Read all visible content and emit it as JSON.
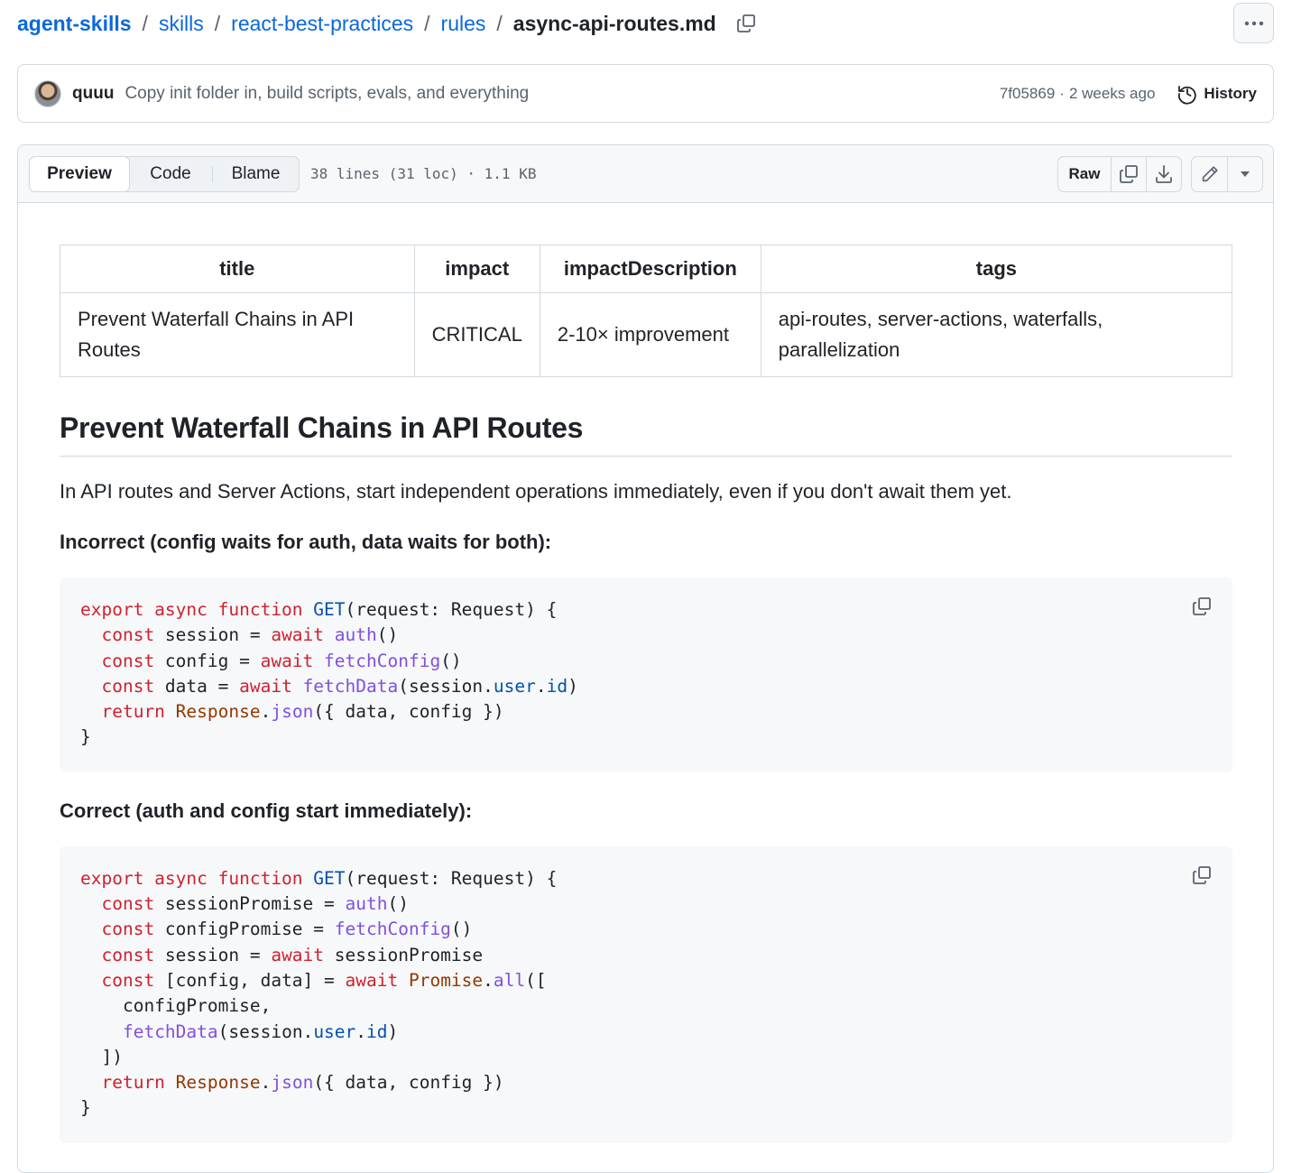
{
  "breadcrumb": {
    "parts": [
      "agent-skills",
      "skills",
      "react-best-practices",
      "rules"
    ],
    "current": "async-api-routes.md",
    "separator": "/"
  },
  "commit": {
    "author": "quuu",
    "message": "Copy init folder in, build scripts, evals, and everything",
    "hash": "7f05869",
    "time": "2 weeks ago",
    "meta_sep": "·",
    "history_label": "History"
  },
  "file_header": {
    "tabs": [
      "Preview",
      "Code",
      "Blame"
    ],
    "active_tab": "Preview",
    "stats": "38 lines (31 loc) · 1.1 KB",
    "raw_label": "Raw"
  },
  "frontmatter": {
    "headers": [
      "title",
      "impact",
      "impactDescription",
      "tags"
    ],
    "row": [
      "Prevent Waterfall Chains in API Routes",
      "CRITICAL",
      "2-10× improvement",
      "api-routes, server-actions, waterfalls, parallelization"
    ]
  },
  "doc": {
    "heading": "Prevent Waterfall Chains in API Routes",
    "intro": "In API routes and Server Actions, start independent operations immediately, even if you don't await them yet.",
    "incorrect_label": "Incorrect (config waits for auth, data waits for both):",
    "correct_label": "Correct (auth and config start immediately):",
    "incorrect_code": [
      [
        [
          "kw",
          "export async function "
        ],
        [
          "en",
          "GET"
        ],
        [
          "",
          "(request: Request) {"
        ]
      ],
      [
        [
          "",
          "  "
        ],
        [
          "kw",
          "const"
        ],
        [
          "",
          " session = "
        ],
        [
          "kw",
          "await "
        ],
        [
          "fn",
          "auth"
        ],
        [
          "",
          "()"
        ]
      ],
      [
        [
          "",
          "  "
        ],
        [
          "kw",
          "const"
        ],
        [
          "",
          " config = "
        ],
        [
          "kw",
          "await "
        ],
        [
          "fn",
          "fetchConfig"
        ],
        [
          "",
          "()"
        ]
      ],
      [
        [
          "",
          "  "
        ],
        [
          "kw",
          "const"
        ],
        [
          "",
          " data = "
        ],
        [
          "kw",
          "await "
        ],
        [
          "fn",
          "fetchData"
        ],
        [
          "",
          "(session."
        ],
        [
          "en",
          "user"
        ],
        [
          "",
          "."
        ],
        [
          "en",
          "id"
        ],
        [
          "",
          ")"
        ]
      ],
      [
        [
          "",
          "  "
        ],
        [
          "kw",
          "return "
        ],
        [
          "cls",
          "Response"
        ],
        [
          "",
          "."
        ],
        [
          "fn",
          "json"
        ],
        [
          "",
          "({ data, config })"
        ]
      ],
      [
        [
          "",
          "}"
        ]
      ]
    ],
    "correct_code": [
      [
        [
          "kw",
          "export async function "
        ],
        [
          "en",
          "GET"
        ],
        [
          "",
          "(request: Request) {"
        ]
      ],
      [
        [
          "",
          "  "
        ],
        [
          "kw",
          "const"
        ],
        [
          "",
          " sessionPromise = "
        ],
        [
          "fn",
          "auth"
        ],
        [
          "",
          "()"
        ]
      ],
      [
        [
          "",
          "  "
        ],
        [
          "kw",
          "const"
        ],
        [
          "",
          " configPromise = "
        ],
        [
          "fn",
          "fetchConfig"
        ],
        [
          "",
          "()"
        ]
      ],
      [
        [
          "",
          "  "
        ],
        [
          "kw",
          "const"
        ],
        [
          "",
          " session = "
        ],
        [
          "kw",
          "await"
        ],
        [
          "",
          " sessionPromise"
        ]
      ],
      [
        [
          "",
          "  "
        ],
        [
          "kw",
          "const"
        ],
        [
          "",
          " [config, data] = "
        ],
        [
          "kw",
          "await "
        ],
        [
          "cls",
          "Promise"
        ],
        [
          "",
          "."
        ],
        [
          "fn",
          "all"
        ],
        [
          "",
          "(["
        ]
      ],
      [
        [
          "",
          "    configPromise,"
        ]
      ],
      [
        [
          "",
          "    "
        ],
        [
          "fn",
          "fetchData"
        ],
        [
          "",
          "(session."
        ],
        [
          "en",
          "user"
        ],
        [
          "",
          "."
        ],
        [
          "en",
          "id"
        ],
        [
          "",
          ")"
        ]
      ],
      [
        [
          "",
          "  ])"
        ]
      ],
      [
        [
          "",
          "  "
        ],
        [
          "kw",
          "return "
        ],
        [
          "cls",
          "Response"
        ],
        [
          "",
          "."
        ],
        [
          "fn",
          "json"
        ],
        [
          "",
          "({ data, config })"
        ]
      ],
      [
        [
          "",
          "}"
        ]
      ]
    ]
  },
  "icons": {
    "copy_path": "copy-icon",
    "more": "kebab-horizontal-icon",
    "history": "history-icon",
    "copy_raw": "copy-icon",
    "download": "download-icon",
    "edit": "pencil-icon",
    "edit_menu": "triangle-down-icon",
    "copy_code": "copy-icon"
  },
  "colors": {
    "link": "#0969da",
    "keyword": "#cf222e",
    "function": "#8250df",
    "entity": "#0550ae",
    "class": "#953800"
  }
}
